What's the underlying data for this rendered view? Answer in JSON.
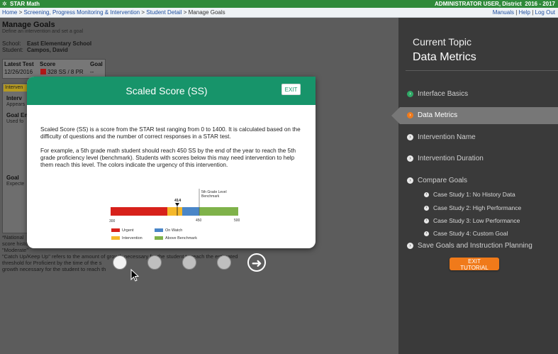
{
  "app": {
    "name": "STAR Math",
    "user": "ADMINISTRATOR USER, District",
    "year": "2016 - 2017"
  },
  "breadcrumb": [
    "Home",
    "Screening, Progress Monitoring & Intervention",
    "Student Detail",
    "Manage Goals"
  ],
  "top_links": [
    "Manuals",
    "Help",
    "Log Out"
  ],
  "page": {
    "title": "Manage Goals",
    "subtitle": "Define an intervention and set a goal",
    "school_label": "School:",
    "school": "East Elementary School",
    "student_label": "Student:",
    "student": "Campos, David",
    "table_headers": [
      "Latest Test",
      "Score",
      "Goal"
    ],
    "table_row": {
      "date": "12/26/2016",
      "score": "328 SS / 8 PR",
      "goal": "--"
    },
    "box_tab": "Interven",
    "box_labels": [
      "Interv",
      "Appears",
      "Goal En",
      "Used fo",
      "Goal",
      "Expecte"
    ],
    "footnotes": [
      "*National",
      "score histo",
      "\"Moderate\"",
      "\"Catch Up/Keep Up\" refers to the amount of growth necessary for the student to reach the estimated",
      "threshold for Proficient by the time of the s",
      "growth necessary for the student to reach th"
    ]
  },
  "modal": {
    "title": "Scaled Score (SS)",
    "exit_label": "EXIT",
    "paragraphs": [
      "Scaled Score (SS) is a score from the STAR test ranging from 0 to 1400. It is calculated based on the difficulty of questions and the number of correct responses in a STAR test.",
      "For example, a 5th grade math student should reach 450 SS by the end of the year to reach the 5th grade proficiency level (benchmark). Students with scores below this may need intervention to help them reach this level. The colors indicate the urgency of this intervention."
    ],
    "bar": {
      "benchmark_label_1": "5th Grade Level",
      "benchmark_label_2": "Benchmark",
      "marker_value": "414",
      "ticks": [
        "300",
        "450",
        "500"
      ],
      "segments": [
        {
          "name": "Urgent",
          "color": "#d7211b"
        },
        {
          "name": "Intervention",
          "color": "#f5b82a"
        },
        {
          "name": "On Watch",
          "color": "#4a86c8"
        },
        {
          "name": "Above Benchmark",
          "color": "#7fb24a"
        }
      ],
      "legend": [
        "Urgent",
        "Intervention",
        "On Watch",
        "Above Benchmark"
      ]
    }
  },
  "tutorial": {
    "current_topic_label": "Current Topic",
    "current_topic": "Data Metrics",
    "nav": [
      {
        "label": "Interface Basics",
        "state": "done"
      },
      {
        "label": "Data Metrics",
        "state": "active"
      },
      {
        "label": "Intervention Name",
        "state": "todo"
      },
      {
        "label": "Intervention Duration",
        "state": "todo"
      },
      {
        "label": "Compare Goals",
        "state": "todo"
      }
    ],
    "sub_items": [
      "Case Study 1: No History Data",
      "Case Study 2: High Performance",
      "Case Study 3: Low Performance",
      "Case Study 4: Custom Goal"
    ],
    "last_item": "Save Goals and Instruction Planning",
    "exit_label": "EXIT TUTORIAL"
  },
  "pager": {
    "count": 4,
    "active_index": 0
  },
  "colors": {
    "header_green": "#2f8a3a",
    "modal_green": "#17946a",
    "accent_orange": "#f07a1a"
  }
}
